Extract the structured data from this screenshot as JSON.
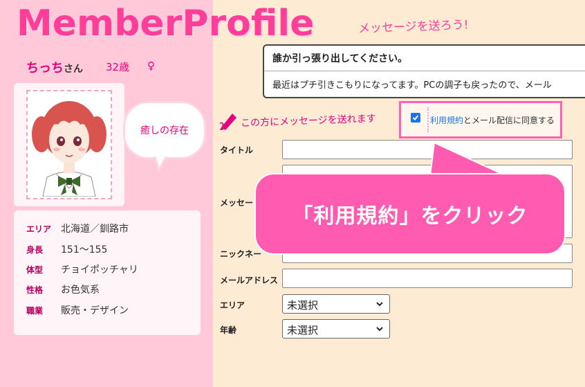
{
  "header": {
    "logo_text": "MemberProfile",
    "tagline": "メッセージを送ろう!"
  },
  "profile": {
    "name": "ちっち",
    "name_suffix": "さん",
    "age": "32歳",
    "gender": "♀",
    "bubble_text": "癒しの存在",
    "details": [
      {
        "key": "エリア",
        "value": "北海道／釧路市"
      },
      {
        "key": "身長",
        "value": "151～155"
      },
      {
        "key": "体型",
        "value": "チョイポッチャリ"
      },
      {
        "key": "性格",
        "value": "お色気系"
      },
      {
        "key": "職業",
        "value": "販売・デザイン"
      }
    ]
  },
  "message_preview": {
    "title": "誰か引っ張り出してください。",
    "body": "最近はプチ引きこもりになってます。PCの調子も戻ったので、メール"
  },
  "send_form": {
    "heading": "この方にメッセージを送れます",
    "agree_link": "利用規約",
    "agree_text": "とメール配信に同意する",
    "agree_checked": true,
    "fields": {
      "title_label": "タイトル",
      "message_label": "メッセー",
      "nickname_label": "ニックネー",
      "email_label": "メールアドレス",
      "area_label": "エリア",
      "age_label": "年齢"
    },
    "area_select": "未選択",
    "age_select": "未選択"
  },
  "callout": {
    "text": "「利用規約」をクリック"
  },
  "colors": {
    "accent_pink": "#ff3e9a",
    "left_bg": "#ffc9d9",
    "right_bg": "#fdebd4",
    "callout": "#ff5bb1",
    "checkbox_blue": "#1a73e8"
  }
}
